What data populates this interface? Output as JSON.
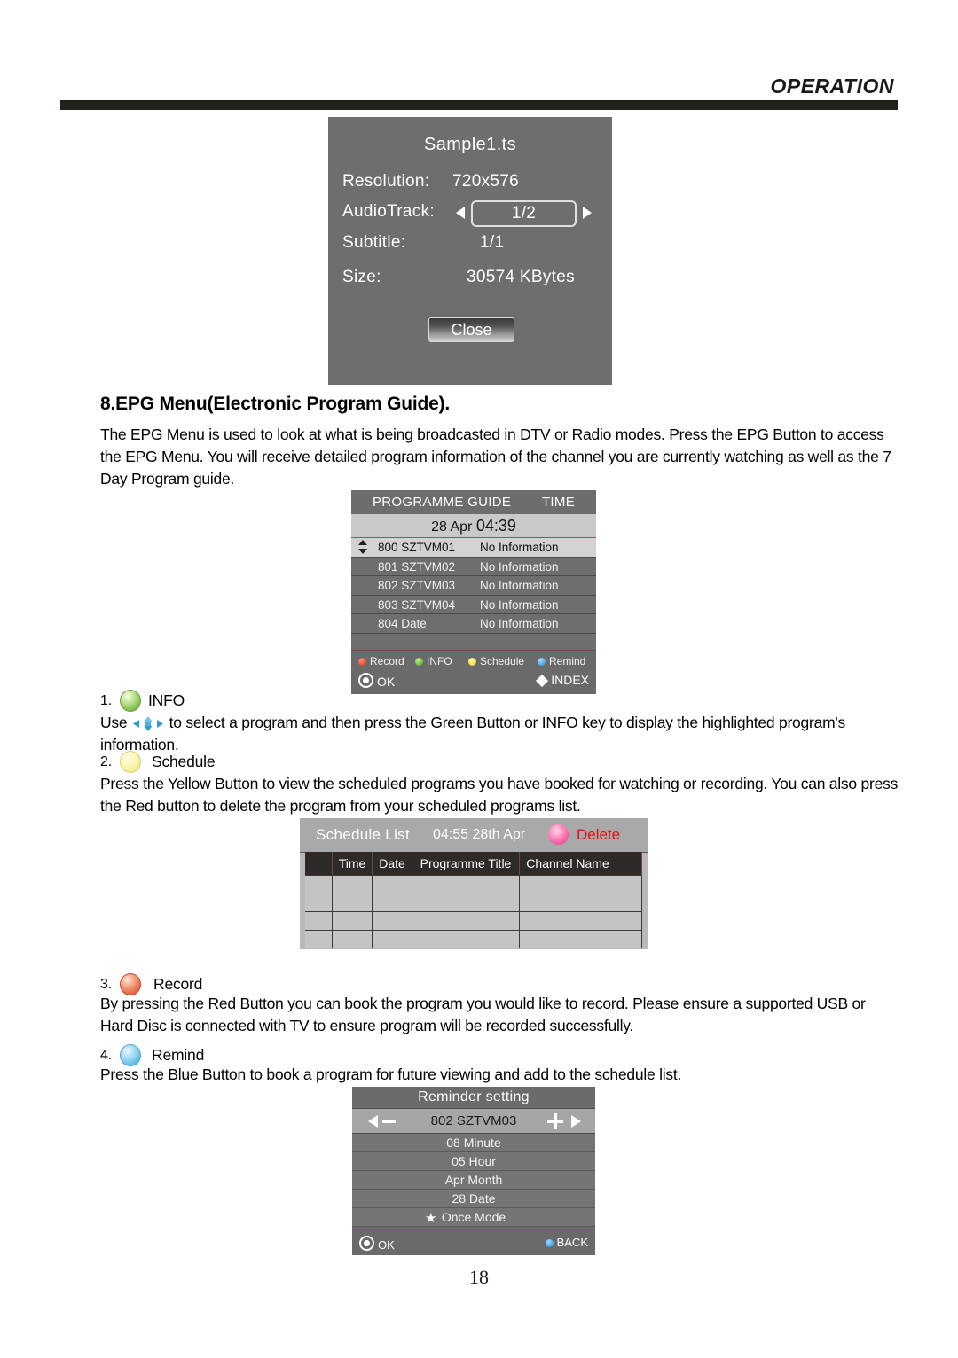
{
  "header": {
    "title": "OPERATION"
  },
  "file_info": {
    "filename": "Sample1.ts",
    "resolution_label": "Resolution:",
    "resolution_value": "720x576",
    "audiotrack_label": "AudioTrack:",
    "audiotrack_value": "1/2",
    "subtitle_label": "Subtitle:",
    "subtitle_value": "1/1",
    "size_label": "Size:",
    "size_value": "30574 KBytes",
    "close_label": "Close"
  },
  "section": {
    "heading": "8.EPG Menu(Electronic Program Guide).",
    "intro": "The EPG Menu is used to look at what is being broadcasted in DTV or Radio modes. Press the EPG Button to access the EPG Menu. You will receive detailed program information of the channel you are currently watching as well as the 7 Day Program guide."
  },
  "epg_guide": {
    "title": "PROGRAMME GUIDE",
    "time_label": "TIME",
    "date_text": "28 Apr ",
    "clock": "04:39",
    "rows": [
      {
        "channel": "800 SZTVM01",
        "info": "No Information",
        "selected": true
      },
      {
        "channel": "801 SZTVM02",
        "info": "No Information",
        "selected": false
      },
      {
        "channel": "802 SZTVM03",
        "info": "No Information",
        "selected": false
      },
      {
        "channel": "803 SZTVM04",
        "info": "No Information",
        "selected": false
      },
      {
        "channel": "804 Date",
        "info": "No Information",
        "selected": false
      }
    ],
    "footer": {
      "record": "Record",
      "info": "INFO",
      "schedule": "Schedule",
      "remind": "Remind",
      "ok": "OK",
      "index": "INDEX"
    },
    "colors": {
      "record": "#d9361a",
      "info": "#4aa01c",
      "schedule": "#e0d018",
      "remind": "#1b8fd8"
    }
  },
  "steps": [
    {
      "number": "1.",
      "label": "INFO",
      "color": "green",
      "body": "Use   to select a program and then press the Green Button or INFO key to display the highlighted program's information."
    },
    {
      "number": "2.",
      "label": "Schedule",
      "color": "yellow",
      "body": "Press the Yellow Button to view the scheduled programs you have booked for watching or recording. You can also press the Red button to delete the program from your scheduled programs list."
    },
    {
      "number": "3.",
      "label": "Record",
      "color": "red",
      "body": "By pressing the Red Button you can book the program you would like to record. Please ensure a supported USB or Hard Disc is connected with TV to ensure program will be recorded successfully."
    },
    {
      "number": "4.",
      "label": "Remind",
      "color": "blue",
      "body": "Press the Blue Button to book a program for future viewing and add to the schedule list."
    }
  ],
  "step1_body_pre": "Use",
  "step1_body_post": "to select a program and then press the Green Button or INFO key to display the highlighted program's information.",
  "schedule_list": {
    "title": "Schedule List",
    "time": "04:55 28th Apr",
    "delete_label": "Delete",
    "columns": [
      "",
      "Time",
      "Date",
      "Programme Title",
      "Channel Name",
      ""
    ],
    "rows": [
      [
        "",
        "",
        "",
        "",
        "",
        ""
      ],
      [
        "",
        "",
        "",
        "",
        "",
        ""
      ],
      [
        "",
        "",
        "",
        "",
        "",
        ""
      ],
      [
        "",
        "",
        "",
        "",
        "",
        ""
      ]
    ]
  },
  "reminder": {
    "title": "Reminder setting",
    "channel": "802 SZTVM03",
    "rows": [
      "08 Minute",
      "05 Hour",
      "Apr Month",
      "28 Date"
    ],
    "mode_row": "Once Mode",
    "ok": "OK",
    "back": "BACK"
  },
  "page_number": "18"
}
